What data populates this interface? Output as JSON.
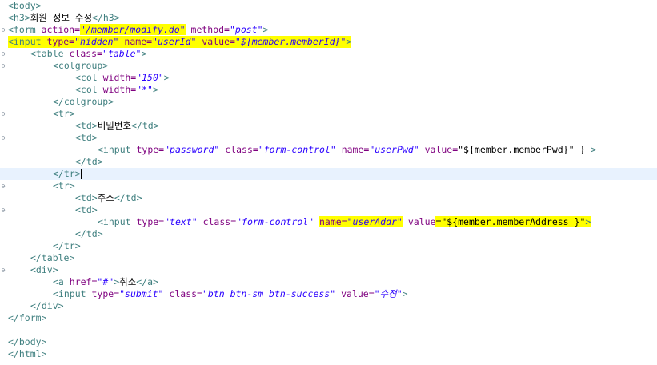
{
  "editor": {
    "current_line": 14,
    "lines": [
      {
        "fold": "",
        "indent": 0,
        "tokens": [
          {
            "t": "tag",
            "s": "<body>"
          }
        ]
      },
      {
        "fold": "",
        "indent": 0,
        "tokens": [
          {
            "t": "tag",
            "s": "<h3>"
          },
          {
            "t": "txt",
            "s": "회원 정보 수정"
          },
          {
            "t": "tag",
            "s": "</h3>"
          }
        ]
      },
      {
        "fold": "minus",
        "indent": 0,
        "tokens": [
          {
            "t": "tag",
            "s": "<form "
          },
          {
            "t": "attr",
            "s": "action="
          },
          {
            "t": "val",
            "s": "\"/member/modify.do\"",
            "hl": true
          },
          {
            "t": "txt",
            "s": " "
          },
          {
            "t": "attr",
            "s": "method="
          },
          {
            "t": "val",
            "s": "\"post\""
          },
          {
            "t": "tag",
            "s": ">"
          }
        ]
      },
      {
        "fold": "",
        "indent": 0,
        "hl_line": true,
        "tokens": [
          {
            "t": "tag",
            "s": "<input "
          },
          {
            "t": "attr",
            "s": "type="
          },
          {
            "t": "val",
            "s": "\"hidden\""
          },
          {
            "t": "txt",
            "s": " "
          },
          {
            "t": "attr",
            "s": "name="
          },
          {
            "t": "val",
            "s": "\"userId\""
          },
          {
            "t": "txt",
            "s": " "
          },
          {
            "t": "attr",
            "s": "value="
          },
          {
            "t": "val",
            "s": "\"${member.memberId}\""
          },
          {
            "t": "tag",
            "s": ">"
          }
        ]
      },
      {
        "fold": "minus",
        "indent": 1,
        "tokens": [
          {
            "t": "tag",
            "s": "<table "
          },
          {
            "t": "attr",
            "s": "class="
          },
          {
            "t": "val",
            "s": "\"table\""
          },
          {
            "t": "tag",
            "s": ">"
          }
        ]
      },
      {
        "fold": "minus",
        "indent": 2,
        "tokens": [
          {
            "t": "tag",
            "s": "<colgroup>"
          }
        ]
      },
      {
        "fold": "",
        "indent": 3,
        "tokens": [
          {
            "t": "tag",
            "s": "<col "
          },
          {
            "t": "attr",
            "s": "width="
          },
          {
            "t": "val",
            "s": "\"150\""
          },
          {
            "t": "tag",
            "s": ">"
          }
        ]
      },
      {
        "fold": "",
        "indent": 3,
        "tokens": [
          {
            "t": "tag",
            "s": "<col "
          },
          {
            "t": "attr",
            "s": "width="
          },
          {
            "t": "val",
            "s": "\"*\""
          },
          {
            "t": "tag",
            "s": ">"
          }
        ]
      },
      {
        "fold": "",
        "indent": 2,
        "tokens": [
          {
            "t": "tag",
            "s": "</colgroup>"
          }
        ]
      },
      {
        "fold": "minus",
        "indent": 2,
        "tokens": [
          {
            "t": "tag",
            "s": "<tr>"
          }
        ]
      },
      {
        "fold": "",
        "indent": 3,
        "tokens": [
          {
            "t": "tag",
            "s": "<td>"
          },
          {
            "t": "txt",
            "s": "비밀번호"
          },
          {
            "t": "tag",
            "s": "</td>"
          }
        ]
      },
      {
        "fold": "minus",
        "indent": 3,
        "tokens": [
          {
            "t": "tag",
            "s": "<td>"
          }
        ]
      },
      {
        "fold": "",
        "indent": 4,
        "tokens": [
          {
            "t": "tag",
            "s": "<input "
          },
          {
            "t": "attr",
            "s": "type="
          },
          {
            "t": "val",
            "s": "\"password\""
          },
          {
            "t": "txt",
            "s": " "
          },
          {
            "t": "attr",
            "s": "class="
          },
          {
            "t": "val",
            "s": "\"form-control\""
          },
          {
            "t": "txt",
            "s": " "
          },
          {
            "t": "attr",
            "s": "name="
          },
          {
            "t": "val",
            "s": "\"userPwd\""
          },
          {
            "t": "txt",
            "s": " "
          },
          {
            "t": "attr",
            "s": "value="
          },
          {
            "t": "txt",
            "s": "\"${member.memberPwd}\" } "
          },
          {
            "t": "tag",
            "s": ">"
          }
        ]
      },
      {
        "fold": "",
        "indent": 3,
        "tokens": [
          {
            "t": "tag",
            "s": "</td>"
          }
        ]
      },
      {
        "fold": "",
        "indent": 2,
        "current": true,
        "tokens": [
          {
            "t": "tag",
            "s": "</tr>"
          }
        ]
      },
      {
        "fold": "minus",
        "indent": 2,
        "tokens": [
          {
            "t": "tag",
            "s": "<tr>"
          }
        ]
      },
      {
        "fold": "",
        "indent": 3,
        "tokens": [
          {
            "t": "tag",
            "s": "<td>"
          },
          {
            "t": "txt",
            "s": "주소"
          },
          {
            "t": "tag",
            "s": "</td>"
          }
        ]
      },
      {
        "fold": "minus",
        "indent": 3,
        "tokens": [
          {
            "t": "tag",
            "s": "<td>"
          }
        ]
      },
      {
        "fold": "",
        "indent": 4,
        "tokens": [
          {
            "t": "tag",
            "s": "<input "
          },
          {
            "t": "attr",
            "s": "type="
          },
          {
            "t": "val",
            "s": "\"text\""
          },
          {
            "t": "txt",
            "s": " "
          },
          {
            "t": "attr",
            "s": "class="
          },
          {
            "t": "val",
            "s": "\"form-control\""
          },
          {
            "t": "txt",
            "s": " "
          },
          {
            "t": "attr",
            "s": "name=",
            "hl": true
          },
          {
            "t": "val",
            "s": "\"userAddr\"",
            "hl": true
          },
          {
            "t": "txt",
            "s": " "
          },
          {
            "t": "attr",
            "s": "value"
          },
          {
            "t": "txt",
            "s": "=\"${member.memberAddress }\"",
            "hl": true
          },
          {
            "t": "tag",
            "s": ">",
            "hl": true
          }
        ]
      },
      {
        "fold": "",
        "indent": 3,
        "tokens": [
          {
            "t": "tag",
            "s": "</td>"
          }
        ]
      },
      {
        "fold": "",
        "indent": 2,
        "tokens": [
          {
            "t": "tag",
            "s": "</tr>"
          }
        ]
      },
      {
        "fold": "",
        "indent": 1,
        "tokens": [
          {
            "t": "tag",
            "s": "</table>"
          }
        ]
      },
      {
        "fold": "minus",
        "indent": 1,
        "tokens": [
          {
            "t": "tag",
            "s": "<div>"
          }
        ]
      },
      {
        "fold": "",
        "indent": 2,
        "tokens": [
          {
            "t": "tag",
            "s": "<a "
          },
          {
            "t": "attr",
            "s": "href="
          },
          {
            "t": "val",
            "s": "\"#\""
          },
          {
            "t": "tag",
            "s": ">"
          },
          {
            "t": "txt",
            "s": "취소"
          },
          {
            "t": "tag",
            "s": "</a>"
          }
        ]
      },
      {
        "fold": "",
        "indent": 2,
        "tokens": [
          {
            "t": "tag",
            "s": "<input "
          },
          {
            "t": "attr",
            "s": "type="
          },
          {
            "t": "val",
            "s": "\"submit\""
          },
          {
            "t": "txt",
            "s": " "
          },
          {
            "t": "attr",
            "s": "class="
          },
          {
            "t": "val",
            "s": "\"btn btn-sm btn-success\""
          },
          {
            "t": "txt",
            "s": " "
          },
          {
            "t": "attr",
            "s": "value="
          },
          {
            "t": "val",
            "s": "\"수정\""
          },
          {
            "t": "tag",
            "s": ">"
          }
        ]
      },
      {
        "fold": "",
        "indent": 1,
        "tokens": [
          {
            "t": "tag",
            "s": "</div>"
          }
        ]
      },
      {
        "fold": "",
        "indent": 0,
        "tokens": [
          {
            "t": "tag",
            "s": "</form>"
          }
        ]
      },
      {
        "fold": "",
        "indent": 0,
        "tokens": []
      },
      {
        "fold": "",
        "indent": 0,
        "tokens": [
          {
            "t": "tag",
            "s": "</body>"
          }
        ]
      },
      {
        "fold": "",
        "indent": 0,
        "tokens": [
          {
            "t": "tag",
            "s": "</html>"
          }
        ]
      }
    ]
  },
  "colors": {
    "tag": "#3f7f7f",
    "attribute": "#7f007f",
    "value": "#2a00ff",
    "highlight": "#ffff00",
    "current_line": "#e8f2fe"
  }
}
